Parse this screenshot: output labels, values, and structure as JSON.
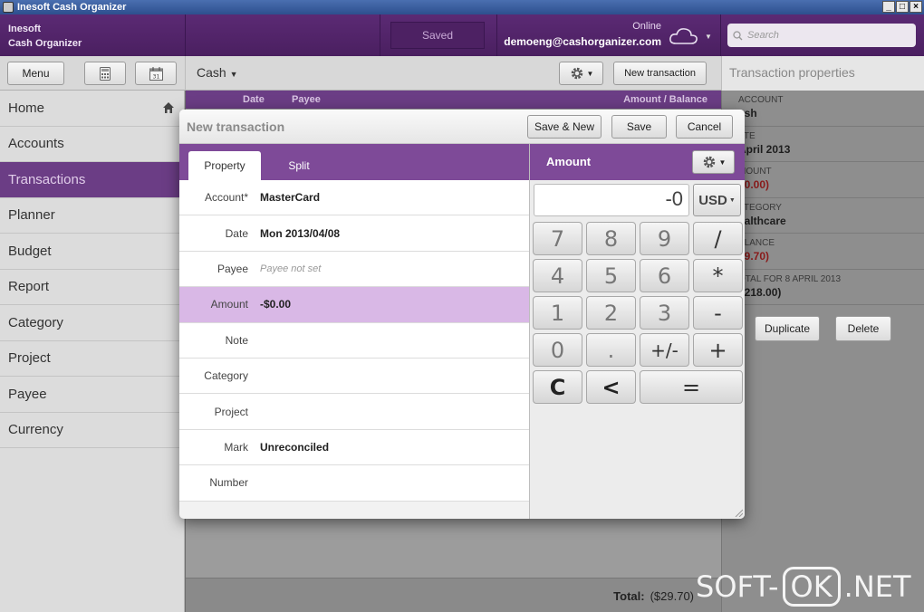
{
  "window": {
    "title": "Inesoft Cash Organizer"
  },
  "header": {
    "brand_line1": "Inesoft",
    "brand_line2": "Cash Organizer",
    "saved": "Saved",
    "online": "Online",
    "email": "demoeng@cashorganizer.com",
    "search_placeholder": "Search"
  },
  "toolbar": {
    "menu": "Menu",
    "account": "Cash",
    "new_transaction": "New transaction",
    "properties_title": "Transaction properties"
  },
  "sidebar": {
    "items": [
      {
        "label": "Home"
      },
      {
        "label": "Accounts"
      },
      {
        "label": "Transactions"
      },
      {
        "label": "Planner"
      },
      {
        "label": "Budget"
      },
      {
        "label": "Report"
      },
      {
        "label": "Category"
      },
      {
        "label": "Project"
      },
      {
        "label": "Payee"
      },
      {
        "label": "Currency"
      }
    ],
    "active": "Transactions"
  },
  "list": {
    "col_date": "Date",
    "col_payee": "Payee",
    "col_amount": "Amount / Balance",
    "total_label": "Total:",
    "total_value": "($29.70)"
  },
  "properties": {
    "rows": [
      {
        "label": "ACCOUNT",
        "value": "ash"
      },
      {
        "label": "ATE",
        "value": " April 2013"
      },
      {
        "label": "MOUNT",
        "value": "80.00)"
      },
      {
        "label": "ATEGORY",
        "value": "ealthcare"
      },
      {
        "label": "ALANCE",
        "value": "29.70)"
      },
      {
        "label": "OTAL FOR 8 APRIL 2013",
        "value": "$218.00)"
      }
    ],
    "duplicate": "Duplicate",
    "delete": "Delete"
  },
  "dialog": {
    "title": "New transaction",
    "save_new": "Save & New",
    "save": "Save",
    "cancel": "Cancel",
    "tabs": {
      "property": "Property",
      "split": "Split"
    },
    "fields": [
      {
        "label": "Account*",
        "value": "MasterCard"
      },
      {
        "label": "Date",
        "value": "Mon 2013/04/08"
      },
      {
        "label": "Payee",
        "value": "Payee not set"
      },
      {
        "label": "Amount",
        "value": "-$0.00"
      },
      {
        "label": "Note",
        "value": ""
      },
      {
        "label": "Category",
        "value": ""
      },
      {
        "label": "Project",
        "value": ""
      },
      {
        "label": "Mark",
        "value": "Unreconciled"
      },
      {
        "label": "Number",
        "value": ""
      }
    ],
    "calc": {
      "title": "Amount",
      "display": "-0",
      "currency": "USD",
      "keys": [
        "7",
        "8",
        "9",
        "/",
        "4",
        "5",
        "6",
        "*",
        "1",
        "2",
        "3",
        "-",
        "0",
        ".",
        "+/-",
        "+",
        "C",
        "<",
        "="
      ]
    }
  },
  "watermark": {
    "left": "SOFT-",
    "ok": "OK",
    "right": ".NET"
  }
}
